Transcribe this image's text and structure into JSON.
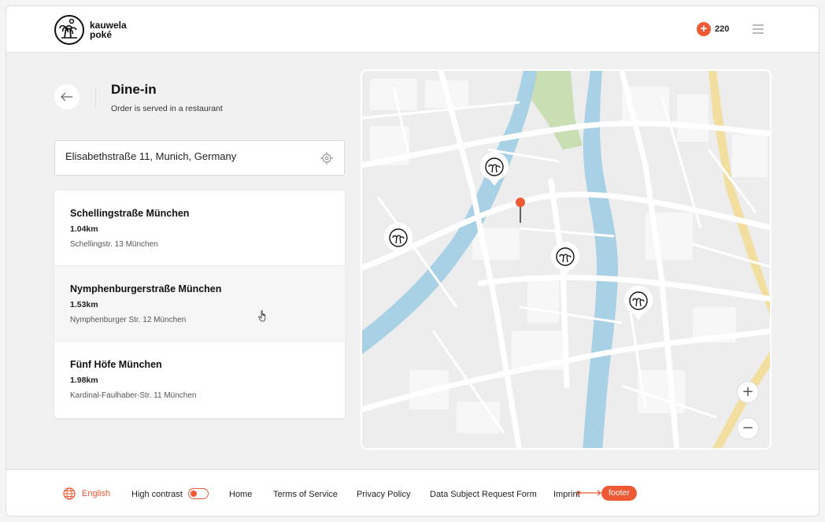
{
  "header": {
    "brand_line1": "kauwela",
    "brand_line2": "poké",
    "points_value": "220",
    "points_icon": "plus-badge-icon",
    "menu_icon": "hamburger-menu-icon"
  },
  "page": {
    "title": "Dine-in",
    "subtitle": "Order is served in a restaurant"
  },
  "address": {
    "value": "Elisabethstraße 11, Munich, Germany"
  },
  "restaurants": [
    {
      "name": "Schellingstraße München",
      "distance": "1.04km",
      "address": "Schellingstr. 13 München"
    },
    {
      "name": "Nymphenburgerstraße München",
      "distance": "1.53km",
      "address": "Nymphenburger Str. 12 München"
    },
    {
      "name": "Fünf Höfe München",
      "distance": "1.98km",
      "address": "Kardinal-Faulhaber-Str. 11 München"
    }
  ],
  "map": {
    "zoom_in": "+",
    "zoom_out": "−"
  },
  "footer": {
    "language": "English",
    "high_contrast": "High contrast",
    "home": "Home",
    "terms": "Terms of Service",
    "privacy": "Privacy Policy",
    "dsr": "Data Subject Request Form",
    "imprint": "Imprint",
    "badge": "footer"
  },
  "colors": {
    "accent": "#ee5a35",
    "river": "#a9d1e5",
    "park": "#c9dfb3",
    "highway": "#f2dfa0"
  }
}
